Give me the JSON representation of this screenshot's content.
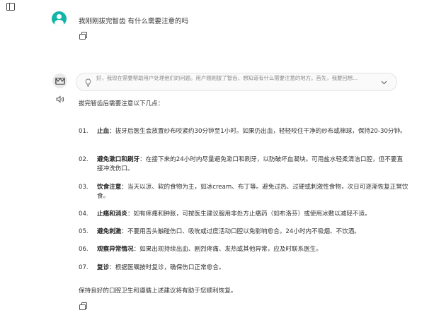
{
  "user_message": "我刚刚拔完智齿 有什么需要注意的吗",
  "reasoning": {
    "text": "好，我现在需要帮助用户处理他们的问题。用户刚刚拔了智齿，想知道有什么需要注意的地方。首先，我要回想..."
  },
  "answer": {
    "intro": "拔完智齿后需要注意以下几点：",
    "items": [
      {
        "num": "01.",
        "title": "止血",
        "text": "：拔牙后医生会放置纱布咬紧约30分钟至1小时。如果仍出血，轻轻咬住干净的纱布或棉球，保持20-30分钟。"
      },
      {
        "num": "02.",
        "title": "避免漱口和刷牙",
        "text": "：在接下来的24小时内尽量避免漱口和刷牙，以防破坏血凝块。可用盐水轻柔清洁口腔，但不要直接冲洗伤口。"
      },
      {
        "num": "03.",
        "title": "饮食注意",
        "text": "：当天以凉、软的食物为主，如冰cream、布丁等。避免过热、过硬或刺激性食物，次日可逐渐恢复正常饮食。"
      },
      {
        "num": "04.",
        "title": "止痛和消炎",
        "text": "：如有疼痛和肿胀，可按医生建议服用非处方止痛药（如布洛芬）或使用冰敷以减轻不适。"
      },
      {
        "num": "05.",
        "title": "避免刺激",
        "text": "：不要用舌头触碰伤口、吸吮或过度活动口腔以免影响愈合。24小时内不吸烟、不饮酒。"
      },
      {
        "num": "06.",
        "title": "观察异常情况",
        "text": "：如果出现持续出血、剧烈疼痛、发热或其他异常，应及时联系医生。"
      },
      {
        "num": "07.",
        "title": "复诊",
        "text": "：根据医嘱按时复诊，确保伤口正常愈合。"
      }
    ],
    "outro": "保持良好的口腔卫生和遵循上述建议将有助于您顺利恢复。"
  },
  "icons": {
    "sidebar": "sidebar-toggle-icon",
    "user_avatar": "user-avatar-icon",
    "copy": "copy-icon",
    "bot_avatar": "bot-logo-icon",
    "speaker": "speaker-icon",
    "bulb": "lightbulb-icon",
    "chevron": "chevron-down-icon"
  },
  "colors": {
    "user_avatar": "#12b5a7",
    "reasoning_bg": "#fafafa",
    "reasoning_text": "#8a8a8a"
  }
}
